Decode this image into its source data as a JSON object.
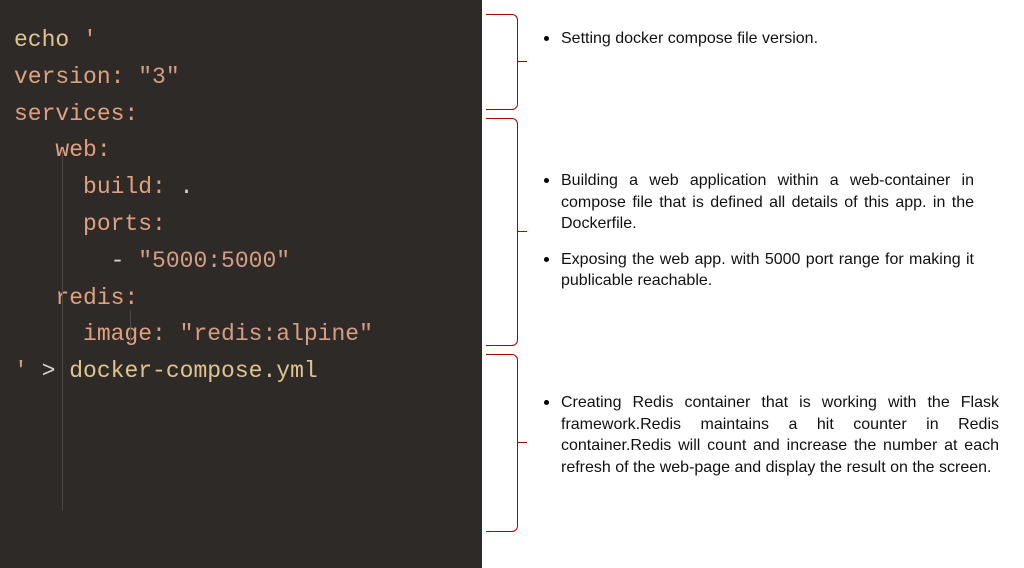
{
  "code": {
    "l1_cmd": "echo",
    "l1_q": " '",
    "l2_key": "version:",
    "l2_val": " \"3\"",
    "l3_key": "services:",
    "l4_key": "web:",
    "l5_key": "build:",
    "l5_val": " .",
    "l6_key": "ports:",
    "l7_dash": "- ",
    "l7_val": "\"5000:5000\"",
    "l8_key": "redis:",
    "l9_key": "image:",
    "l9_val": " \"redis:alpine\"",
    "l10_q": "'",
    "l10_gt": " > ",
    "l10_file": "docker-compose.yml"
  },
  "notes": {
    "n1": "Setting  docker compose  file version.",
    "n2": "Building a web application within a web-container in compose file that is defined all details of this app. in the Dockerfile.",
    "n3": "Exposing the web app. with 5000 port range for making it publicable reachable.",
    "n4": "Creating   Redis container that is working with the Flask framework.Redis maintains a hit counter in Redis container.Redis will count and increase the number at each  refresh of the web-page and display the result on the screen."
  }
}
